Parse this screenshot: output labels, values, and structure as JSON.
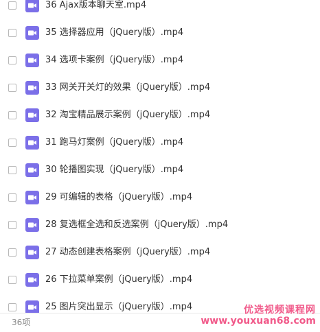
{
  "files": [
    {
      "name": "36 Ajax版本聊天室.mp4"
    },
    {
      "name": "35 选择器应用（jQuery版）.mp4"
    },
    {
      "name": "34 选项卡案例（jQuery版）.mp4"
    },
    {
      "name": "33 网关开关灯的效果（jQuery版）.mp4"
    },
    {
      "name": "32 淘宝精品展示案例（jQuery版）.mp4"
    },
    {
      "name": "31 跑马灯案例（jQuery版）.mp4"
    },
    {
      "name": "30 轮播图实现（jQuery版）.mp4"
    },
    {
      "name": "29 可编辑的表格（jQuery版）.mp4"
    },
    {
      "name": "28 复选框全选和反选案例（jQuery版）.mp4"
    },
    {
      "name": "27 动态创建表格案例（jQuery版）.mp4"
    },
    {
      "name": "26 下拉菜单案例（jQuery版）.mp4"
    },
    {
      "name": "25 图片突出显示（jQuery版）.mp4"
    }
  ],
  "footer": {
    "count": "36项"
  },
  "watermark": {
    "brand": "优选视频课程网",
    "url": "www.youxuan68.com"
  },
  "colors": {
    "icon_purple": "#7b6fe8",
    "watermark_pink": "#f15a8a"
  },
  "icons": {
    "file": "video-file-icon"
  }
}
